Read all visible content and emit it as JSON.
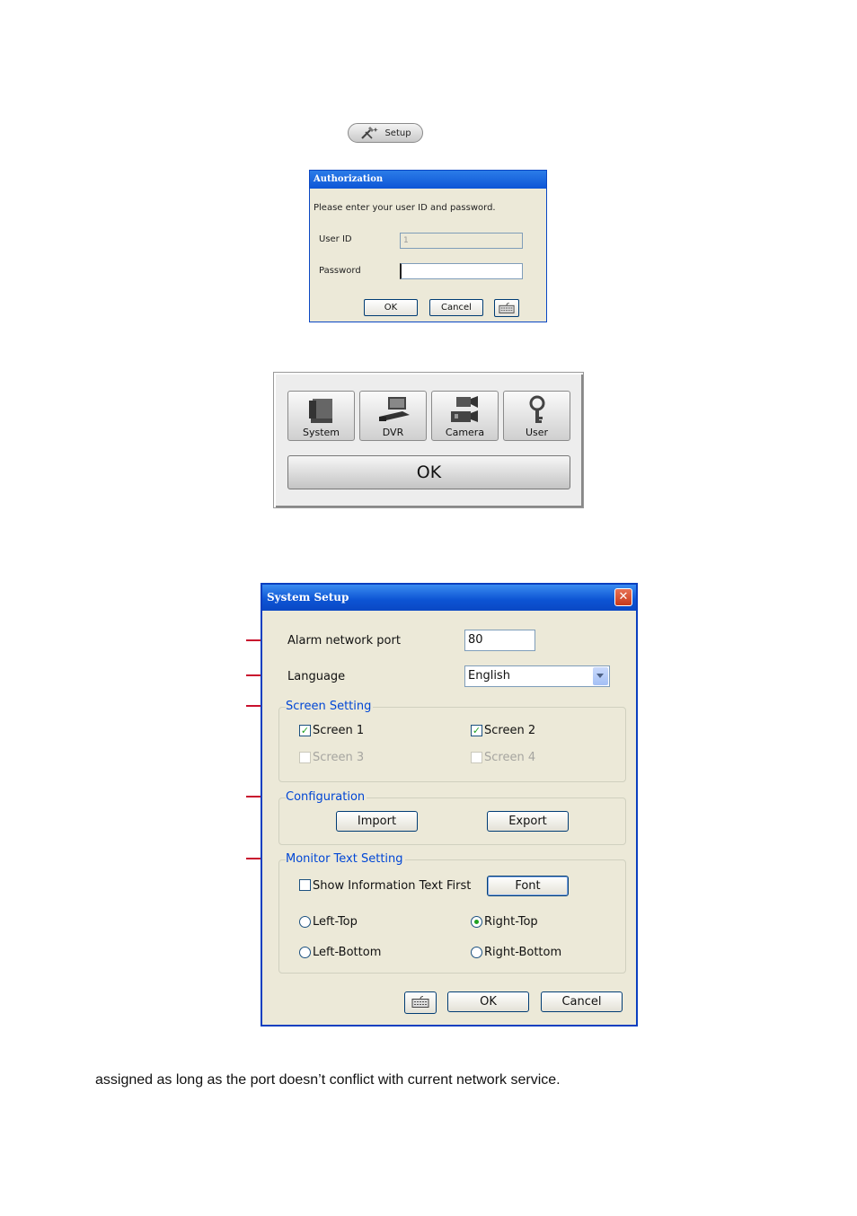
{
  "setup_button": {
    "label": "Setup",
    "icon": "tools-icon"
  },
  "auth_dialog": {
    "title": "Authorization",
    "prompt": "Please enter your user ID and password.",
    "user_id_label": "User ID",
    "user_id_value": "1",
    "password_label": "Password",
    "password_value": "",
    "ok_label": "OK",
    "cancel_label": "Cancel",
    "keyboard_icon": "keyboard-icon"
  },
  "launcher": {
    "items": [
      {
        "label": "System",
        "icon": "monitor-icon"
      },
      {
        "label": "DVR",
        "icon": "dvr-icon"
      },
      {
        "label": "Camera",
        "icon": "camera-icon"
      },
      {
        "label": "User",
        "icon": "key-icon"
      }
    ],
    "ok_label": "OK"
  },
  "system_setup": {
    "title": "System Setup",
    "close_icon": "close-icon",
    "alarm_port_label": "Alarm network port",
    "alarm_port_value": "80",
    "language_label": "Language",
    "language_value": "English",
    "screen_setting": {
      "title": "Screen Setting",
      "screens": [
        {
          "label": "Screen 1",
          "checked": true,
          "enabled": true
        },
        {
          "label": "Screen 2",
          "checked": true,
          "enabled": true
        },
        {
          "label": "Screen 3",
          "checked": false,
          "enabled": false
        },
        {
          "label": "Screen 4",
          "checked": false,
          "enabled": false
        }
      ]
    },
    "configuration": {
      "title": "Configuration",
      "import_label": "Import",
      "export_label": "Export"
    },
    "monitor_text": {
      "title": "Monitor Text Setting",
      "show_info_label": "Show Information Text First",
      "show_info_checked": false,
      "font_label": "Font",
      "positions": [
        {
          "label": "Left-Top",
          "selected": false
        },
        {
          "label": "Right-Top",
          "selected": true
        },
        {
          "label": "Left-Bottom",
          "selected": false
        },
        {
          "label": "Right-Bottom",
          "selected": false
        }
      ]
    },
    "ok_label": "OK",
    "cancel_label": "Cancel",
    "keyboard_icon": "keyboard-icon"
  },
  "body_text": "assigned as long as the port doesn’t conflict with current network service."
}
